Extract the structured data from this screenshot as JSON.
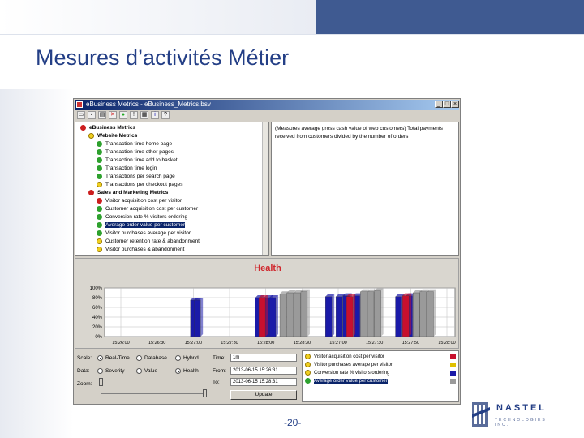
{
  "slide": {
    "title": "Mesures d’activités Métier",
    "page_number": "-20-",
    "logo_text": "NASTEL",
    "logo_sub": "TECHNOLOGIES, INC."
  },
  "window": {
    "title": "eBusiness Metrics - eBusiness_Metrics.bsv",
    "min_label": "_",
    "max_label": "□",
    "close_label": "×"
  },
  "toolbar": [
    "open",
    "save",
    "print",
    "delete",
    "green",
    "alert",
    "grid",
    "info",
    "help"
  ],
  "tree": {
    "items": [
      {
        "label": "eBusiness Metrics",
        "status": "red",
        "level": 0,
        "group": true
      },
      {
        "label": "Website Metrics",
        "status": "yellow",
        "level": 1,
        "group": true
      },
      {
        "label": "Transaction time home page",
        "status": "green",
        "level": 2
      },
      {
        "label": "Transaction time other pages",
        "status": "green",
        "level": 2
      },
      {
        "label": "Transaction time add to basket",
        "status": "green",
        "level": 2
      },
      {
        "label": "Transaction time login",
        "status": "green",
        "level": 2
      },
      {
        "label": "Transactions per search page",
        "status": "green",
        "level": 2
      },
      {
        "label": "Transactions per checkout pages",
        "status": "yellow",
        "level": 2
      },
      {
        "label": "Sales and Marketing Metrics",
        "status": "red",
        "level": 1,
        "group": true
      },
      {
        "label": "Visitor acquisition cost per visitor",
        "status": "red",
        "level": 2
      },
      {
        "label": "Customer acquisition cost per customer",
        "status": "green",
        "level": 2
      },
      {
        "label": "Conversion rate % visitors ordering",
        "status": "green",
        "level": 2
      },
      {
        "label": "Average order value per customer",
        "status": "green",
        "level": 2,
        "selected": true
      },
      {
        "label": "Visitor purchases average per visitor",
        "status": "green",
        "level": 2
      },
      {
        "label": "Customer retention rate & abandonment",
        "status": "yellow",
        "level": 2
      },
      {
        "label": "Visitor purchases & abandonment",
        "status": "yellow",
        "level": 2
      }
    ]
  },
  "description": "(Measures average gross cash value of web customers) Total payments received from customers divided by the number of orders",
  "chart_data": {
    "type": "bar",
    "title": "Health",
    "ylabel": "",
    "ylim": [
      0,
      100
    ],
    "yticks": [
      "0%",
      "20%",
      "40%",
      "60%",
      "80%",
      "100%"
    ],
    "xticks": [
      "15:26:00",
      "15:26:30",
      "15:27:00",
      "15:27:30",
      "15:28:00",
      "15:28:30",
      "15:27:00",
      "15:27:30",
      "15:27:50",
      "15:28:00"
    ],
    "series": [
      {
        "color": "#1a1aa8",
        "values": [
          {
            "x": 0.245,
            "v": 75
          },
          {
            "x": 0.255,
            "v": 75
          },
          {
            "x": 0.43,
            "v": 80
          },
          {
            "x": 0.455,
            "v": 80
          },
          {
            "x": 0.47,
            "v": 80
          },
          {
            "x": 0.63,
            "v": 82
          },
          {
            "x": 0.66,
            "v": 82
          },
          {
            "x": 0.68,
            "v": 84
          },
          {
            "x": 0.71,
            "v": 84
          },
          {
            "x": 0.83,
            "v": 82
          },
          {
            "x": 0.86,
            "v": 84
          }
        ]
      },
      {
        "color": "#c8102e",
        "values": [
          {
            "x": 0.44,
            "v": 80
          },
          {
            "x": 0.69,
            "v": 82
          },
          {
            "x": 0.85,
            "v": 84
          }
        ]
      },
      {
        "color": "#9a9a9a",
        "values": [
          {
            "x": 0.5,
            "v": 88
          },
          {
            "x": 0.52,
            "v": 90
          },
          {
            "x": 0.54,
            "v": 90
          },
          {
            "x": 0.56,
            "v": 92
          },
          {
            "x": 0.73,
            "v": 92
          },
          {
            "x": 0.75,
            "v": 92
          },
          {
            "x": 0.77,
            "v": 94
          },
          {
            "x": 0.88,
            "v": 90
          },
          {
            "x": 0.9,
            "v": 92
          },
          {
            "x": 0.92,
            "v": 92
          }
        ]
      }
    ],
    "grid": true
  },
  "controls": {
    "scale_label": "Scale:",
    "scale_options": [
      "Real-Time",
      "Database",
      "Hybrid"
    ],
    "scale_selected": 0,
    "data_label": "Data:",
    "data_options": [
      "Severity",
      "Value",
      "Health"
    ],
    "data_selected": 2,
    "zoom_label": "Zoom:",
    "time_label": "Time:",
    "time_value": "1m",
    "from_label": "From:",
    "from_value": "2013-06-15 15:26:31",
    "to_label": "To:",
    "to_value": "2013-06-15 15:28:31",
    "update_label": "Update"
  },
  "legend": [
    {
      "label": "Visitor acquisition cost per visitor",
      "color": "#c8102e",
      "status": "yellow"
    },
    {
      "label": "Visitor purchases average per visitor",
      "color": "#e0c000",
      "status": "yellow"
    },
    {
      "label": "Conversion rate % visitors ordering",
      "color": "#1a1aa8",
      "status": "yellow"
    },
    {
      "label": "Average order value per customer",
      "color": "#9a9a9a",
      "status": "green",
      "selected": true
    }
  ]
}
